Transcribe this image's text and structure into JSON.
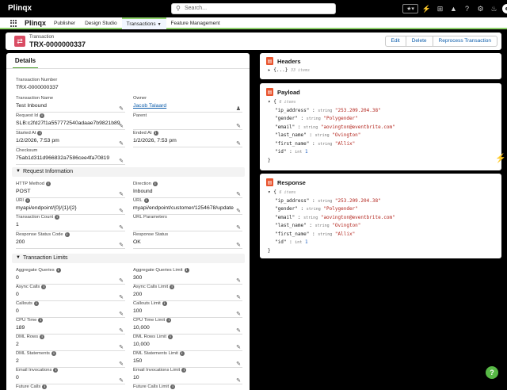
{
  "topbar": {
    "brand": "Plinqx",
    "search_placeholder": "Search..."
  },
  "nav": {
    "app_name": "Plinqx",
    "tabs": [
      {
        "label": "Publisher"
      },
      {
        "label": "Design Studio"
      },
      {
        "label": "Transactions"
      },
      {
        "label": "Feature Management"
      }
    ],
    "active_tab": "Transactions"
  },
  "record": {
    "type": "Transaction",
    "title": "TRX-0000000337",
    "actions": [
      "Edit",
      "Delete",
      "Reprocess Transaction"
    ]
  },
  "details": {
    "tab": "Details",
    "top_fields": [
      {
        "label": "Transaction Number",
        "value": "TRX-0000000337"
      },
      {
        "label": "Transaction Name",
        "value": "Test Inbound"
      },
      {
        "label": "Owner",
        "value": "Jacob Talaard"
      },
      {
        "label": "Request Id",
        "value": "SLB:c2fd27f1a557772540adaae7b9821b89"
      },
      {
        "label": "Parent",
        "value": ""
      },
      {
        "label": "Started At",
        "value": "1/2/2026, 7:53 pm"
      },
      {
        "label": "Ended At",
        "value": "1/2/2026, 7:53 pm"
      },
      {
        "label": "Checksum",
        "value": "75ab1d311d966832a7586cee4fa70819"
      }
    ],
    "request_section": "Request Information",
    "request_fields": [
      {
        "label": "HTTP Method",
        "value": "POST"
      },
      {
        "label": "Direction",
        "value": "Inbound"
      },
      {
        "label": "URI",
        "value": "myapi/endpoint/{0}/{1}/{2}"
      },
      {
        "label": "URL",
        "value": "myapi/endpoint/customer/1254678/update"
      },
      {
        "label": "Transaction Count",
        "value": "1"
      },
      {
        "label": "URL Parameters",
        "value": ""
      },
      {
        "label": "Response Status Code",
        "value": "200"
      },
      {
        "label": "Response Status",
        "value": "OK"
      }
    ],
    "limits_section": "Transaction Limits",
    "limit_fields": [
      {
        "label": "Aggregate Queries",
        "value": "0"
      },
      {
        "label": "Aggregate Queries Limit",
        "value": "300"
      },
      {
        "label": "Async Calls",
        "value": "0"
      },
      {
        "label": "Async Calls Limit",
        "value": "200"
      },
      {
        "label": "Callouts",
        "value": "0"
      },
      {
        "label": "Callouts Limit",
        "value": "100"
      },
      {
        "label": "CPU Time",
        "value": "189"
      },
      {
        "label": "CPU Time Limit",
        "value": "10,000"
      },
      {
        "label": "DML Rows",
        "value": "2"
      },
      {
        "label": "DML Rows Limit",
        "value": "10,000"
      },
      {
        "label": "DML Statements",
        "value": "2"
      },
      {
        "label": "DML Statements Limit",
        "value": "150"
      },
      {
        "label": "Email Invocations",
        "value": "0"
      },
      {
        "label": "Email Invocations Limit",
        "value": "10"
      },
      {
        "label": "Future Calls",
        "value": ""
      },
      {
        "label": "Future Calls Limit",
        "value": ""
      }
    ]
  },
  "headers_card": {
    "title": "Headers",
    "collapsed_text": "{...}",
    "count": "33 items"
  },
  "payload_card": {
    "title": "Payload",
    "count": "6 items",
    "rows": [
      {
        "key": "\"ip_address\"",
        "type": "string",
        "value": "\"253.209.204.38\"",
        "kind": "s"
      },
      {
        "key": "\"gender\"",
        "type": "string",
        "value": "\"Polygender\"",
        "kind": "s"
      },
      {
        "key": "\"email\"",
        "type": "string",
        "value": "\"aovington@eventbrite.com\"",
        "kind": "s"
      },
      {
        "key": "\"last_name\"",
        "type": "string",
        "value": "\"Ovington\"",
        "kind": "s"
      },
      {
        "key": "\"first_name\"",
        "type": "string",
        "value": "\"Allix\"",
        "kind": "s"
      },
      {
        "key": "\"id\"",
        "type": "int",
        "value": "1",
        "kind": "n"
      }
    ]
  },
  "response_card": {
    "title": "Response",
    "count": "6 items",
    "rows": [
      {
        "key": "\"ip_address\"",
        "type": "string",
        "value": "\"253.209.204.38\"",
        "kind": "s"
      },
      {
        "key": "\"gender\"",
        "type": "string",
        "value": "\"Polygender\"",
        "kind": "s"
      },
      {
        "key": "\"email\"",
        "type": "string",
        "value": "\"aovington@eventbrite.com\"",
        "kind": "s"
      },
      {
        "key": "\"last_name\"",
        "type": "string",
        "value": "\"Ovington\"",
        "kind": "s"
      },
      {
        "key": "\"first_name\"",
        "type": "string",
        "value": "\"Allix\"",
        "kind": "s"
      },
      {
        "key": "\"id\"",
        "type": "int",
        "value": "1",
        "kind": "n"
      }
    ]
  },
  "help_label": "?",
  "colors": {
    "accent": "#8fd36b",
    "link": "#0b5cab",
    "record_icon": "#d94c63",
    "json_icon": "#e8532d"
  }
}
